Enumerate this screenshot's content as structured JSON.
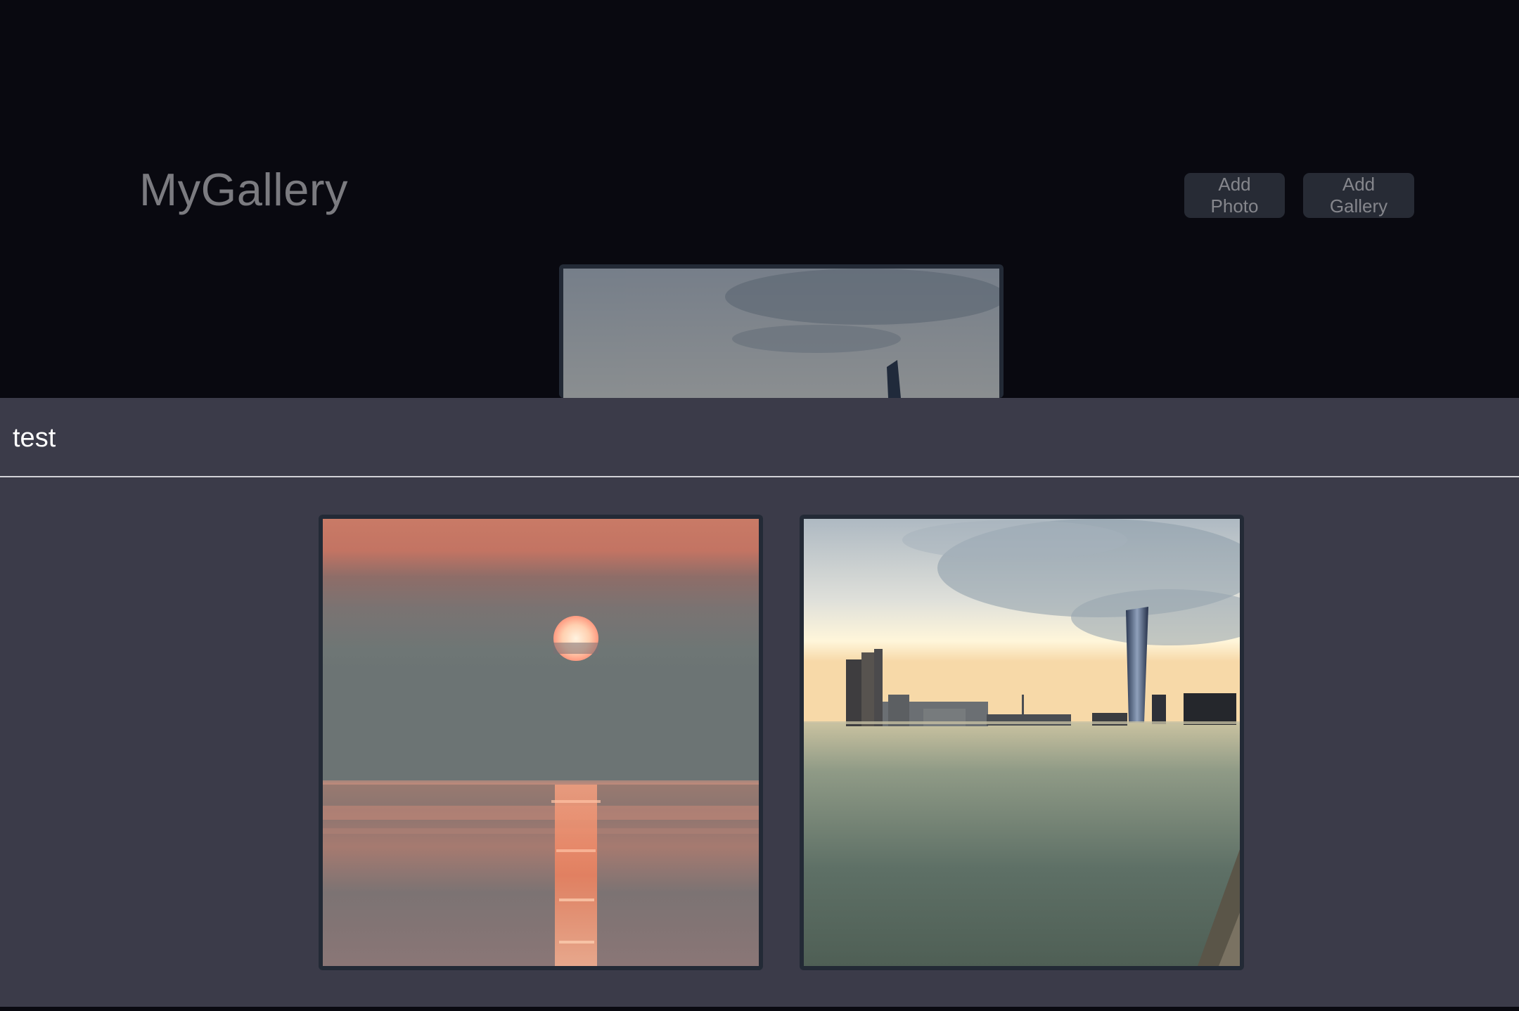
{
  "header": {
    "brand": "MyGallery",
    "buttons": {
      "add_photo": "Add Photo",
      "add_gallery": "Add Gallery"
    }
  },
  "background_gallery": {
    "photos": [
      {
        "alt": "city skyline over water"
      }
    ]
  },
  "modal": {
    "title": "test",
    "photos": [
      {
        "alt": "sunset over the sea"
      },
      {
        "alt": "city skyline over water"
      }
    ]
  },
  "colors": {
    "page_bg": "#090910",
    "overlay_bg": "#3b3b49",
    "button_bg": "#272b35",
    "card_border": "#232a36",
    "brand_text": "#7b7b80",
    "title_text": "#ffffff"
  }
}
